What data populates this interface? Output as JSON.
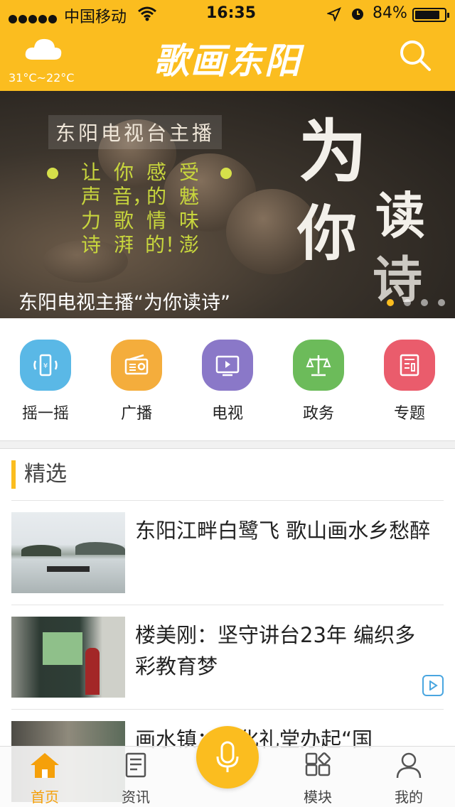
{
  "status_bar": {
    "carrier": "中国移动",
    "time": "16:35",
    "battery_percent": "84%",
    "battery_level": 0.84
  },
  "header": {
    "logo_text": "歌画东阳",
    "temperature": "31°C~22°C",
    "weather_icon": "cloud-icon",
    "search_icon": "search-icon",
    "brand_color": "#fbbd1f"
  },
  "banner": {
    "tag": "东阳电视台主播",
    "poem_columns": [
      "让声力诗",
      "你音，歌湃",
      "感的情的！",
      "受魅味澎"
    ],
    "big_chars": [
      "为",
      "你",
      "读",
      "诗"
    ],
    "caption": "东阳电视主播“为你读诗”",
    "page_count": 4,
    "active_page": 1
  },
  "quick_nav": [
    {
      "label": "摇一摇",
      "icon": "phone-shake-icon",
      "color": "#5ab8e6"
    },
    {
      "label": "广播",
      "icon": "radio-icon",
      "color": "#f4ad3c"
    },
    {
      "label": "电视",
      "icon": "tv-icon",
      "color": "#8a78c8"
    },
    {
      "label": "政务",
      "icon": "scales-icon",
      "color": "#6cbb5a"
    },
    {
      "label": "专题",
      "icon": "document-icon",
      "color": "#ea5c6c"
    }
  ],
  "featured": {
    "title": "精选",
    "items": [
      {
        "title": "东阳江畔白鹭飞 歌山画水乡愁醉",
        "has_video": false
      },
      {
        "title": "楼美刚：坚守讲台23年 编织多彩教育梦",
        "has_video": true
      },
      {
        "title": "画水镇：文化礼堂办起“国",
        "has_video": false
      }
    ]
  },
  "tabbar": {
    "items": [
      {
        "label": "首页",
        "icon": "home-icon",
        "active": true
      },
      {
        "label": "资讯",
        "icon": "news-icon",
        "active": false
      },
      {
        "label": "模块",
        "icon": "modules-icon",
        "active": false
      },
      {
        "label": "我的",
        "icon": "user-icon",
        "active": false
      }
    ],
    "mic_icon": "microphone-icon"
  }
}
